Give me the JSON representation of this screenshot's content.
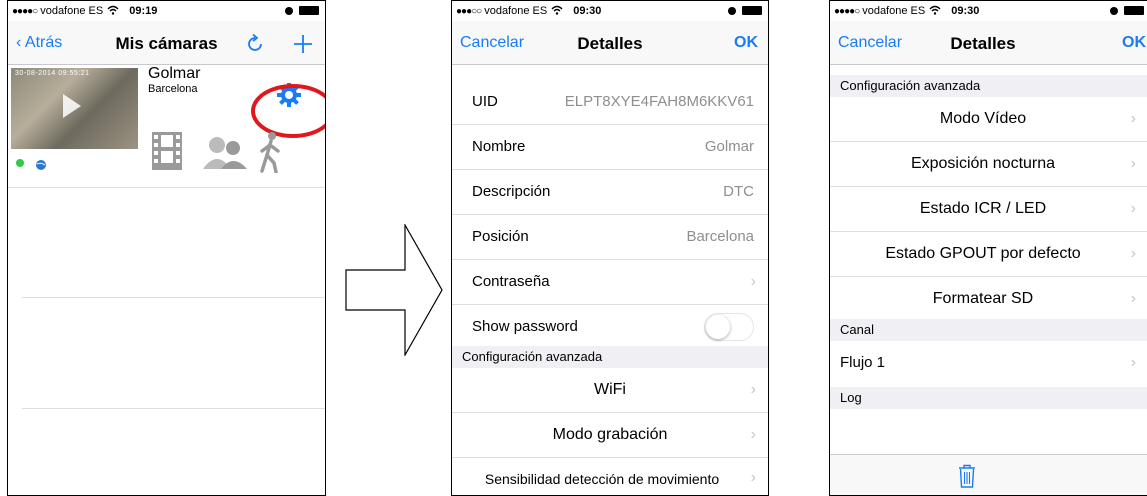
{
  "status": {
    "carrier": "vodafone ES",
    "time1": "09:19",
    "time2": "09:30",
    "time3": "09:30"
  },
  "screen1": {
    "nav": {
      "back_label": "Atrás",
      "title": "Mis cámaras"
    },
    "camera": {
      "name": "Golmar",
      "location": "Barcelona",
      "thumb_timestamp": "30-08-2014 09:55:21"
    },
    "icons": [
      "refresh-icon",
      "add-icon",
      "gear-icon",
      "globe-icon",
      "film-icon",
      "contacts-icon",
      "walker-icon"
    ]
  },
  "screen2": {
    "nav": {
      "cancel_label": "Cancelar",
      "title": "Detalles",
      "ok_label": "OK"
    },
    "fields": [
      {
        "label": "UID",
        "value": "ELPT8XYE4FAH8M6KKV61"
      },
      {
        "label": "Nombre",
        "value": "Golmar"
      },
      {
        "label": "Descripción",
        "value": "DTC"
      },
      {
        "label": "Posición",
        "value": "Barcelona"
      },
      {
        "label": "Contraseña",
        "value": ""
      },
      {
        "label": "Show password",
        "value": ""
      }
    ],
    "show_password_on": false,
    "section_title": "Configuración avanzada",
    "advanced": [
      "WiFi",
      "Modo grabación",
      "Sensibilidad detección de movimiento"
    ]
  },
  "screen3": {
    "nav": {
      "cancel_label": "Cancelar",
      "title": "Detalles",
      "ok_label": "OK"
    },
    "section_advanced": "Configuración avanzada",
    "advanced": [
      "Modo Vídeo",
      "Exposición nocturna",
      "Estado ICR / LED",
      "Estado GPOUT por defecto",
      "Formatear SD"
    ],
    "section_channel": "Canal",
    "channel": "Flujo 1",
    "section_log": "Log"
  },
  "colors": {
    "accent": "#1a7cf5",
    "highlight_ring": "#e0181e",
    "online": "#2ecc40"
  }
}
